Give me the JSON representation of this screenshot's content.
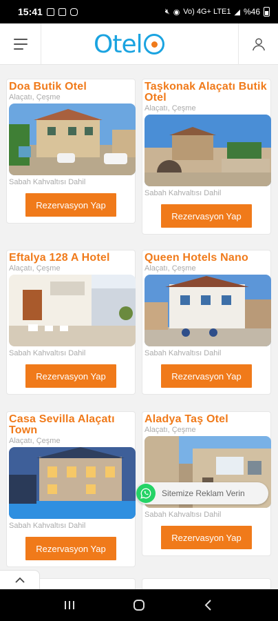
{
  "status": {
    "time": "15:41",
    "network": "Vo) 4G+ LTE1",
    "battery": "%46"
  },
  "header": {
    "logo_text": "Otel",
    "brand_blue": "#1aa3e0",
    "brand_orange": "#f07a1a",
    "menu_icon": "hamburger-icon",
    "user_icon": "user-icon"
  },
  "hotels": [
    {
      "name": "Doa Butik Otel",
      "location": "Alaçatı, Çeşme",
      "meal": "Sabah Kahvaltısı Dahil",
      "button": "Rezervasyon Yap"
    },
    {
      "name": "Taşkonak Alaçatı Butik Otel",
      "location": "Alaçatı, Çeşme",
      "meal": "Sabah Kahvaltısı Dahil",
      "button": "Rezervasyon Yap"
    },
    {
      "name": "Eftalya 128 A Hotel",
      "location": "Alaçatı, Çeşme",
      "meal": "Sabah Kahvaltısı Dahil",
      "button": "Rezervasyon Yap"
    },
    {
      "name": "Queen Hotels Nano",
      "location": "Alaçatı, Çeşme",
      "meal": "Sabah Kahvaltısı Dahil",
      "button": "Rezervasyon Yap"
    },
    {
      "name": "Casa Sevilla Alaçatı Town",
      "location": "Alaçatı, Çeşme",
      "meal": "Sabah Kahvaltısı Dahil",
      "button": "Rezervasyon Yap"
    },
    {
      "name": "Aladya Taş Otel",
      "location": "Alaçatı, Çeşme",
      "meal": "Sabah Kahvaltısı Dahil",
      "button": "Rezervasyon Yap"
    }
  ],
  "whatsapp": {
    "label": "Sitemize Reklam Verin",
    "icon": "whatsapp-icon"
  },
  "scroll_top_icon": "chevron-up-icon",
  "nav": {
    "recents_icon": "recents-icon",
    "home_icon": "home-icon",
    "back_icon": "back-icon"
  }
}
